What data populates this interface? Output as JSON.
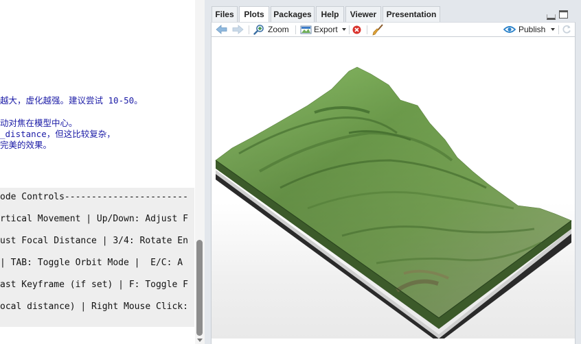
{
  "editor": {
    "lines": [
      "越大，虚化越强。建议尝试 10-50。",
      "动对焦在模型中心。",
      "_distance，但这比较复杂，",
      "完美的效果。"
    ]
  },
  "console": {
    "lines": [
      "ode Controls-----------------------",
      "rtical Movement | Up/Down: Adjust F",
      "ust Focal Distance | 3/4: Rotate En",
      "| TAB: Toggle Orbit Mode |  E/C: A",
      "ast Keyframe (if set) | F: Toggle F",
      "ocal distance) | Right Mouse Click:"
    ]
  },
  "pane": {
    "tabs": [
      {
        "label": "Files",
        "active": false
      },
      {
        "label": "Plots",
        "active": true
      },
      {
        "label": "Packages",
        "active": false
      },
      {
        "label": "Help",
        "active": false
      },
      {
        "label": "Viewer",
        "active": false
      },
      {
        "label": "Presentation",
        "active": false
      }
    ],
    "toolbar": {
      "zoom_label": "Zoom",
      "export_label": "Export",
      "publish_label": "Publish"
    }
  },
  "icons": {
    "back": "arrow-left-icon",
    "forward": "arrow-right-icon",
    "zoom": "magnifier-plus-icon",
    "export": "image-export-icon",
    "remove": "remove-circle-icon",
    "clear": "broom-icon",
    "publish": "publish-eye-icon",
    "refresh": "refresh-icon"
  },
  "colors": {
    "code_text": "#1a1aa6",
    "console_bg": "#eeeeee",
    "accent_blue": "#2b82c9",
    "terrain_green": "#6f9e4f",
    "terrain_base": "#2a2a2a"
  }
}
